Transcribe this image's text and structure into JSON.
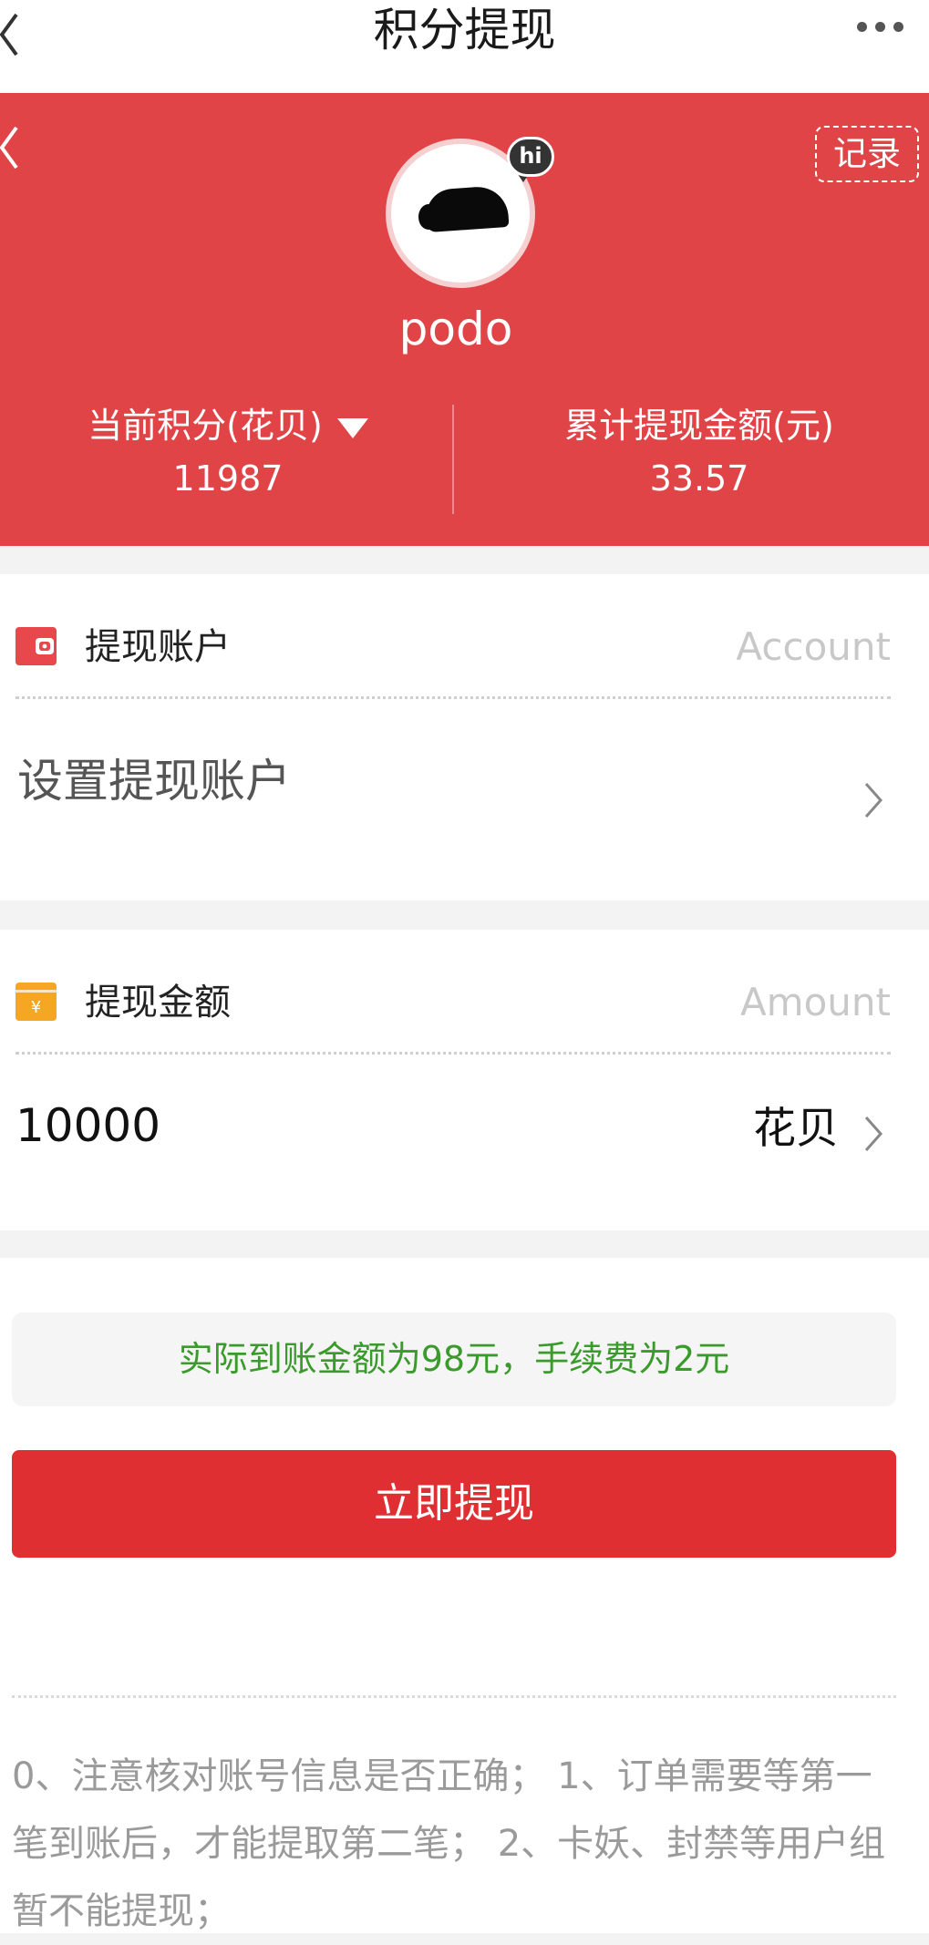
{
  "nav": {
    "title": "积分提现"
  },
  "hero": {
    "record_label": "记录",
    "badge_text": "hi",
    "username": "podo",
    "points_label": "当前积分(花贝)",
    "points_value": "11987",
    "withdrawn_label": "累计提现金额(元)",
    "withdrawn_value": "33.57"
  },
  "account": {
    "title": "提现账户",
    "hint": "Account",
    "placeholder": "设置提现账户"
  },
  "amount": {
    "title": "提现金额",
    "hint": "Amount",
    "value": "10000",
    "unit": "花贝"
  },
  "notice": "实际到账金额为98元，手续费为2元",
  "submit_label": "立即提现",
  "tips": "0、注意核对账号信息是否正确； 1、订单需要等第一笔到账后，才能提取第二笔； 2、卡妖、封禁等用户组暂不能提现；",
  "colors": {
    "brand_red": "#e14447",
    "button_red": "#e02f33",
    "notice_green": "#3a9a2b"
  },
  "icons": {
    "back": "chevron-left-icon",
    "more": "more-dots-icon",
    "wallet": "wallet-icon",
    "yen": "yen-icon",
    "chevron": "chevron-right-icon",
    "dropdown": "caret-down-icon"
  }
}
